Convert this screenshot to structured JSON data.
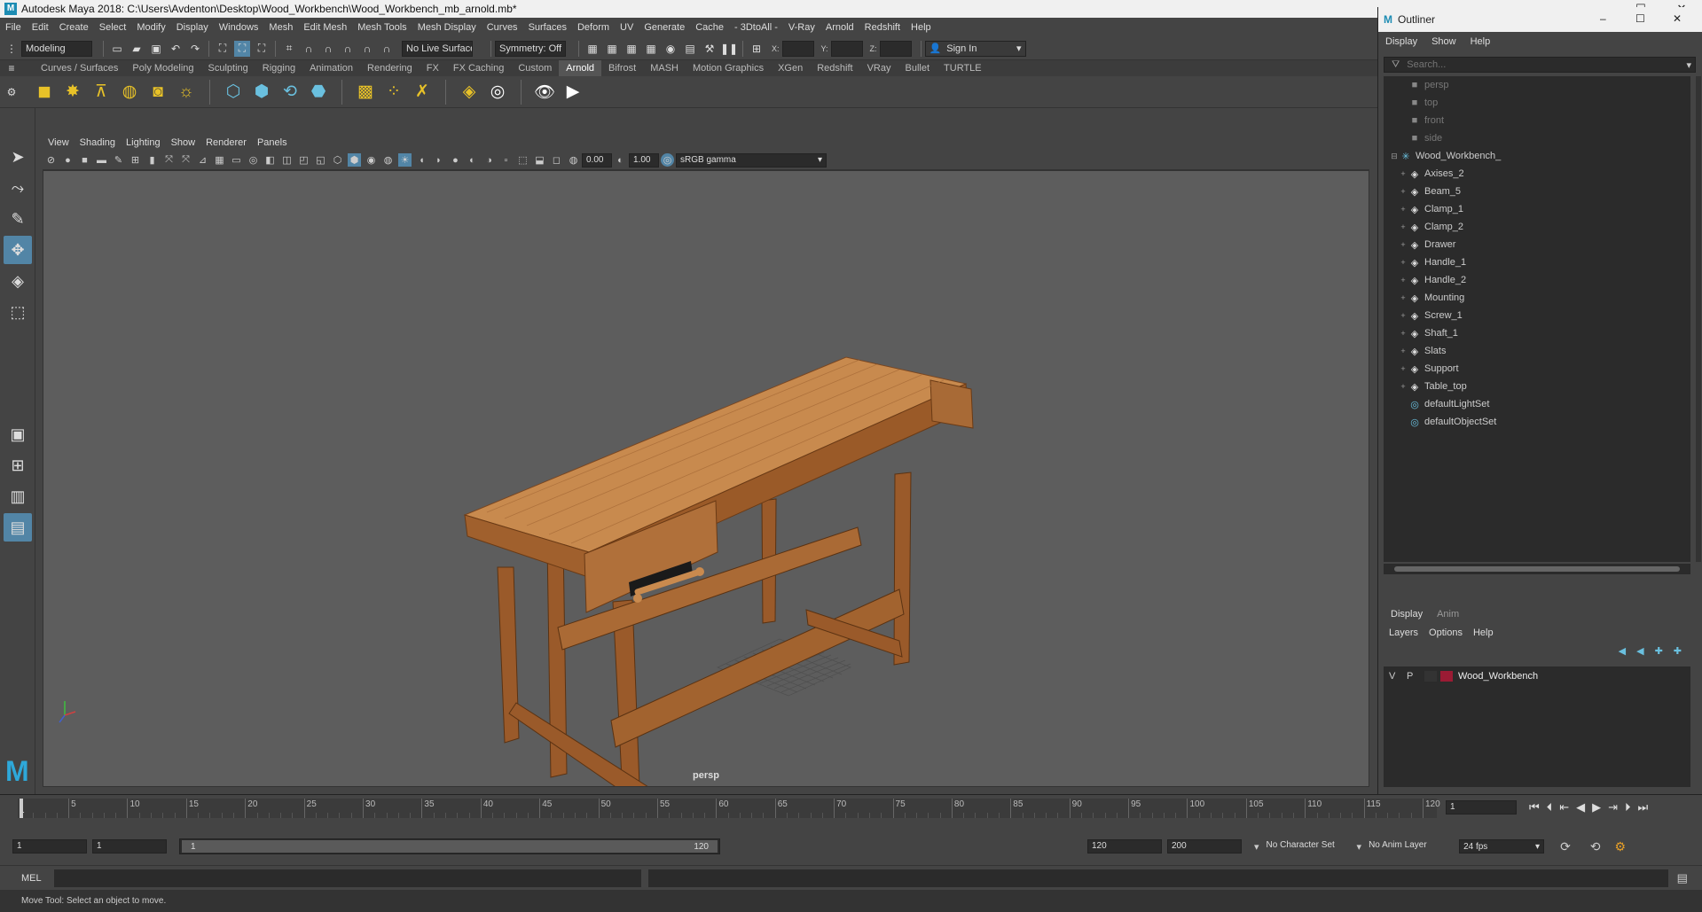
{
  "window": {
    "title": "Autodesk Maya 2018: C:\\Users\\Avdenton\\Desktop\\Wood_Workbench\\Wood_Workbench_mb_arnold.mb*",
    "minimize": "–",
    "maximize": "☐",
    "close": "✕"
  },
  "menus": [
    "File",
    "Edit",
    "Create",
    "Select",
    "Modify",
    "Display",
    "Windows",
    "Mesh",
    "Edit Mesh",
    "Mesh Tools",
    "Mesh Display",
    "Curves",
    "Surfaces",
    "Deform",
    "UV",
    "Generate",
    "Cache",
    "- 3DtoAll -",
    "V-Ray",
    "Arnold",
    "Redshift",
    "Help"
  ],
  "status_line": {
    "mode": "Modeling",
    "live_surface": "No Live Surface",
    "symmetry": "Symmetry: Off",
    "x_label": "X:",
    "y_label": "Y:",
    "z_label": "Z:",
    "sign_in": "Sign In"
  },
  "shelf_tabs": [
    "Curves / Surfaces",
    "Poly Modeling",
    "Sculpting",
    "Rigging",
    "Animation",
    "Rendering",
    "FX",
    "FX Caching",
    "Custom",
    "Arnold",
    "Bifrost",
    "MASH",
    "Motion Graphics",
    "XGen",
    "Redshift",
    "VRay",
    "Bullet",
    "TURTLE"
  ],
  "active_shelf_tab": "Arnold",
  "panel_menu": [
    "View",
    "Shading",
    "Lighting",
    "Show",
    "Renderer",
    "Panels"
  ],
  "panel_toolbar": {
    "exposure": "0.00",
    "gamma": "1.00",
    "color_space": "sRGB gamma"
  },
  "viewport": {
    "camera_label": "persp"
  },
  "outliner": {
    "title": "Outliner",
    "menu": [
      "Display",
      "Show",
      "Help"
    ],
    "search_placeholder": "Search...",
    "cameras": [
      "persp",
      "top",
      "front",
      "side"
    ],
    "root": "Wood_Workbench_",
    "children": [
      "Axises_2",
      "Beam_5",
      "Clamp_1",
      "Clamp_2",
      "Drawer",
      "Handle_1",
      "Handle_2",
      "Mounting",
      "Screw_1",
      "Shaft_1",
      "Slats",
      "Support",
      "Table_top"
    ],
    "sets": [
      "defaultLightSet",
      "defaultObjectSet"
    ]
  },
  "layer_editor": {
    "tabs": [
      "Display",
      "Anim"
    ],
    "menu": [
      "Layers",
      "Options",
      "Help"
    ],
    "layer": {
      "v": "V",
      "p": "P",
      "name": "Wood_Workbench",
      "color": "#9b1b34"
    }
  },
  "timeline": {
    "ticks": [
      5,
      10,
      15,
      20,
      25,
      30,
      35,
      40,
      45,
      50,
      55,
      60,
      65,
      70,
      75,
      80,
      85,
      90,
      95,
      100,
      105,
      110,
      115,
      120
    ],
    "start_label": "1",
    "current_frame": "1",
    "current_frame_marker": 1,
    "max_frame": 120
  },
  "range": {
    "start": "1",
    "playback_start": "1",
    "slider_start": "1",
    "slider_end": "120",
    "end": "120",
    "anim_end": "200",
    "character_set": "No Character Set",
    "anim_layer": "No Anim Layer",
    "fps": "24 fps"
  },
  "command_line": {
    "lang": "MEL"
  },
  "help_line": "Move Tool: Select an object to move.",
  "colors": {
    "accent": "#5285a6",
    "bg": "#444444",
    "field": "#2b2b2b"
  }
}
